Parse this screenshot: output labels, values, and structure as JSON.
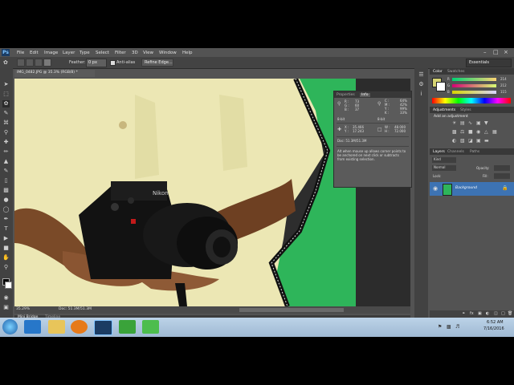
{
  "menubar": {
    "logo": "Ps",
    "items": [
      "File",
      "Edit",
      "Image",
      "Layer",
      "Type",
      "Select",
      "Filter",
      "3D",
      "View",
      "Window",
      "Help"
    ]
  },
  "options": {
    "feather_label": "Feather:",
    "feather_value": "0 px",
    "antialias_label": "Anti-alias",
    "refine_edge": "Refine Edge...",
    "workspace": "Essentials"
  },
  "document": {
    "tab_title": "IMG_0482.JPG @ 35.3% (RGB/8) *",
    "zoom": "35.29%",
    "doc_size": "Doc: 51.3M/51.3M"
  },
  "info_panel": {
    "tabs": [
      "Properties",
      "Info"
    ],
    "c_label": "C :",
    "c_val": "64%",
    "m_label": "M :",
    "m_val": "42%",
    "y_label": "Y :",
    "y_val": "99%",
    "k_label": "K :",
    "k_val": "33%",
    "r_label": "R :",
    "r_val": "73",
    "g_label": "G :",
    "g_val": "60",
    "b_label": "B :",
    "b_val": "37",
    "bit_left": "8-bit",
    "bit_right": "8-bit",
    "x_label": "X :",
    "x_val": "35.466",
    "y2_label": "Y :",
    "y2_val": "17.243",
    "w_label": "W :",
    "w_val": "48.000",
    "h_label": "H :",
    "h_val": "72.000",
    "doc": "Doc: 51.3M/51.3M",
    "hint": "Alt when mouse up allows corner points to be anchored on next click or subtracts from existing selection."
  },
  "color_panel": {
    "tabs": [
      "Color",
      "Swatches"
    ],
    "r_label": "R",
    "r_val": "214",
    "g_label": "G",
    "g_val": "212",
    "b_label": "B",
    "b_val": "115"
  },
  "adjustments_panel": {
    "tabs": [
      "Adjustments",
      "Styles"
    ],
    "heading": "Add an adjustment"
  },
  "layers_panel": {
    "tabs": [
      "Layers",
      "Channels",
      "Paths"
    ],
    "kind": "Kind",
    "mode": "Normal",
    "opacity_label": "Opacity:",
    "lock_label": "Lock:",
    "fill_label": "Fill:",
    "layer_name": "Background"
  },
  "bottom": {
    "mini_bridge": "Mini Bridge",
    "timeline": "Timeline"
  },
  "taskbar": {
    "time": "6:52 AM",
    "date": "7/16/2016",
    "apps": [
      "start",
      "internet-explorer",
      "file-explorer",
      "media-player",
      "photoshop",
      "camtasia-recorder",
      "camtasia-studio"
    ]
  },
  "colors": {
    "green_screen": "#2eb55a",
    "shirt": "#ece7b4",
    "skin": "#7a4a28",
    "ps_accent": "#2f8ae0"
  }
}
